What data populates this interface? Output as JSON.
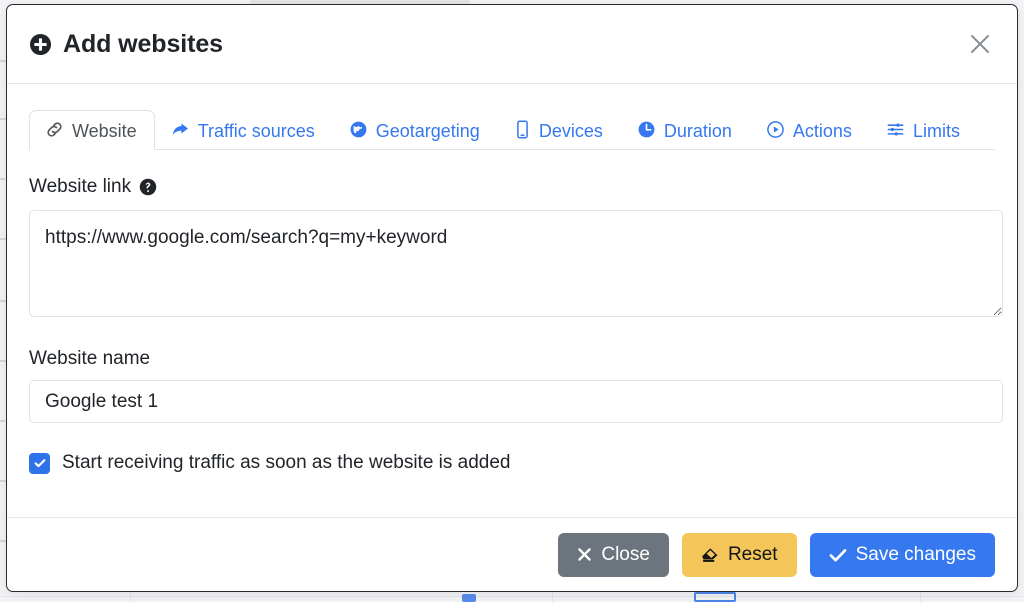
{
  "modal": {
    "title": "Add websites",
    "title_icon": "plus-circle-icon",
    "close_icon": "close-icon"
  },
  "tabs": [
    {
      "label": "Website",
      "icon": "link-icon",
      "active": true
    },
    {
      "label": "Traffic sources",
      "icon": "share-arrow-icon",
      "active": false
    },
    {
      "label": "Geotargeting",
      "icon": "globe-icon",
      "active": false
    },
    {
      "label": "Devices",
      "icon": "mobile-icon",
      "active": false
    },
    {
      "label": "Duration",
      "icon": "clock-icon",
      "active": false
    },
    {
      "label": "Actions",
      "icon": "play-circle-icon",
      "active": false
    },
    {
      "label": "Limits",
      "icon": "sliders-icon",
      "active": false
    }
  ],
  "form": {
    "website_link_label": "Website link",
    "website_link_help_icon": "help-circle-icon",
    "website_link_value": "https://www.google.com/search?q=my+keyword",
    "website_link_placeholder": "https://",
    "website_name_label": "Website name",
    "website_name_value": "Google test 1",
    "website_name_placeholder": "Website name",
    "start_traffic_label": "Start receiving traffic as soon as the website is added",
    "start_traffic_checked": true
  },
  "footer": {
    "close_label": "Close",
    "reset_label": "Reset",
    "save_label": "Save changes"
  },
  "colors": {
    "accent_blue": "#3578f0",
    "secondary_gray": "#6c757d",
    "warning_amber": "#f4c65a",
    "text_dark": "#212529"
  }
}
